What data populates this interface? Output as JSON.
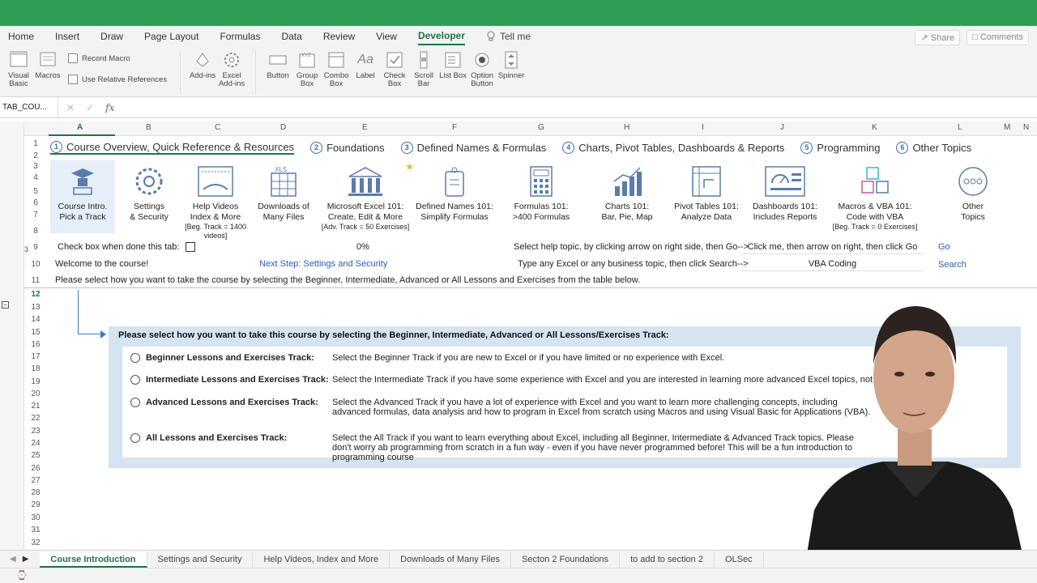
{
  "ribbon": {
    "tabs": [
      "Home",
      "Insert",
      "Draw",
      "Page Layout",
      "Formulas",
      "Data",
      "Review",
      "View",
      "Developer"
    ],
    "active_tab": "Developer",
    "tell_me": "Tell me",
    "share": "Share",
    "comments": "Comments",
    "visual_basic": "Visual Basic",
    "macros": "Macros",
    "record_macro": "Record Macro",
    "use_relative": "Use Relative References",
    "add_ins": "Add-ins",
    "excel_add_ins": "Excel Add-ins",
    "controls": [
      "Button",
      "Group Box",
      "Combo Box",
      "Label",
      "Check Box",
      "Scroll Bar",
      "List Box",
      "Option Button",
      "Spinner"
    ]
  },
  "formula_bar": {
    "name_box": "TAB_COU...",
    "fx": "fx"
  },
  "grid": {
    "columns": [
      "A",
      "B",
      "C",
      "D",
      "E",
      "F",
      "G",
      "H",
      "I",
      "J",
      "K",
      "L",
      "M",
      "N"
    ],
    "active_column": "A",
    "rows": [
      "1",
      "2",
      "3",
      "4",
      "5",
      "6",
      "7",
      "8",
      "9",
      "10",
      "11",
      "12",
      "13",
      "14",
      "15",
      "16",
      "17",
      "18",
      "19",
      "20",
      "21",
      "22",
      "23",
      "24",
      "25",
      "26",
      "27",
      "28",
      "29",
      "30",
      "31",
      "32"
    ],
    "active_row": "12",
    "levels": "1 2 3"
  },
  "nav": [
    {
      "num": "1",
      "label": "Course Overview, Quick Reference & Resources"
    },
    {
      "num": "2",
      "label": "Foundations"
    },
    {
      "num": "3",
      "label": "Defined Names & Formulas"
    },
    {
      "num": "4",
      "label": "Charts, Pivot Tables, Dashboards & Reports"
    },
    {
      "num": "5",
      "label": "Programming"
    },
    {
      "num": "6",
      "label": "Other Topics"
    }
  ],
  "tiles": [
    {
      "l1": "Course Intro.",
      "l2": "Pick a Track",
      "sub": ""
    },
    {
      "l1": "Settings",
      "l2": "& Security",
      "sub": ""
    },
    {
      "l1": "Help Videos",
      "l2": "Index & More",
      "sub": "[Beg. Track = 1400 videos]"
    },
    {
      "l1": "Downloads of",
      "l2": "Many Files",
      "sub": ""
    },
    {
      "l1": "Microsoft Excel 101:",
      "l2": "Create, Edit & More",
      "sub": "[Adv. Track = 50 Exercises]"
    },
    {
      "l1": "Defined Names 101:",
      "l2": "Simplify Formulas",
      "sub": ""
    },
    {
      "l1": "Formulas 101:",
      "l2": ">400 Formulas",
      "sub": ""
    },
    {
      "l1": "Charts 101:",
      "l2": "Bar, Pie, Map",
      "sub": ""
    },
    {
      "l1": "Pivot Tables 101:",
      "l2": "Analyze Data",
      "sub": ""
    },
    {
      "l1": "Dashboards 101:",
      "l2": "Includes Reports",
      "sub": ""
    },
    {
      "l1": "Macros & VBA 101:",
      "l2": "Code with VBA",
      "sub": "[Beg. Track = 0 Exercises]"
    },
    {
      "l1": "Other",
      "l2": "Topics",
      "sub": ""
    }
  ],
  "rows_text": {
    "check_done": "Check box when done this tab:",
    "percent": "0%",
    "help_topic": "Select help topic, by clicking arrow on right side, then Go-->",
    "click_me": "Click me, then arrow on right, then click Go",
    "go": "Go",
    "welcome": "Welcome to the course!",
    "next_step": "Next Step: Settings and Security",
    "type_topic": "Type any Excel or any business topic, then click Search-->",
    "search_value": "VBA Coding",
    "search": "Search",
    "please_select": "Please select how you want to take the course by selecting the Beginner, Intermediate, Advanced or All Lessons and Exercises from the table below."
  },
  "track": {
    "title": "Please select how you want to take this course by selecting the Beginner, Intermediate, Advanced or All Lessons/Exercises Track:",
    "options": [
      {
        "label": "Beginner Lessons and Exercises Track:",
        "desc": "Select the Beginner Track if you are new to Excel or if you have limited or no experience with Excel."
      },
      {
        "label": "Intermediate Lessons and Exercises Track:",
        "desc": "Select the Intermediate Track if you have some experience with Excel and you are interested in learning more advanced Excel topics, not including M"
      },
      {
        "label": "Advanced Lessons and Exercises Track:",
        "desc": "Select the Advanced Track if you have a lot of experience with Excel and you want to learn more challenging concepts, including advanced formulas, data analysis and how to program in Excel from scratch using Macros and using Visual Basic for Applications (VBA)."
      },
      {
        "label": "All Lessons and Exercises Track:",
        "desc": "Select the All Track if you want to learn everything about Excel, including all Beginner, Intermediate & Advanced Track topics. Please don't worry ab programming from scratch in a fun way - even if you have never programmed before! This will be a fun introduction to programming course"
      }
    ]
  },
  "sheet_tabs": [
    "Course Introduction",
    "Settings and Security",
    "Help Videos, Index and More",
    "Downloads of Many Files",
    "Secton 2 Foundations",
    "to add to section 2",
    "OLSec"
  ],
  "colors": {
    "excel_green": "#217346",
    "title_green": "#2f9e58",
    "accent_blue": "#3a6fb5",
    "panel_blue": "#d6e4f2"
  }
}
